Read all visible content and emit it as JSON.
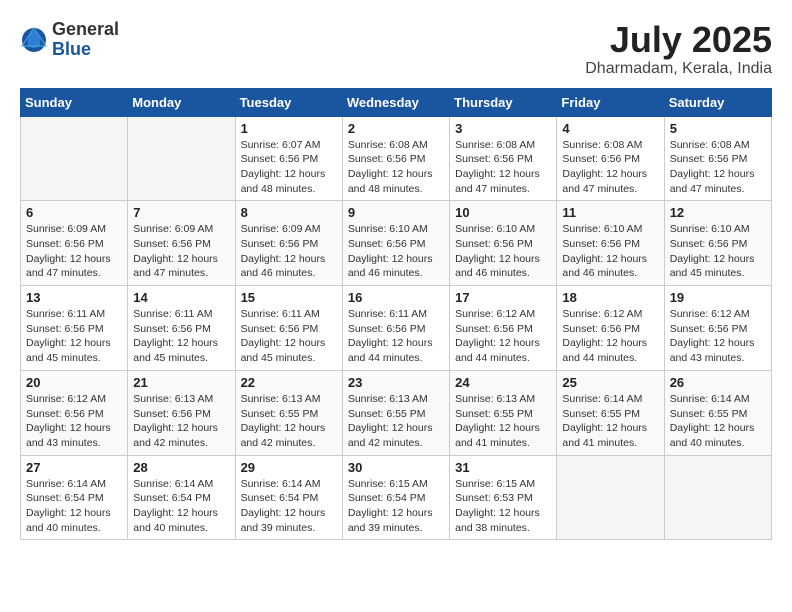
{
  "logo": {
    "general": "General",
    "blue": "Blue"
  },
  "title": "July 2025",
  "location": "Dharmadam, Kerala, India",
  "days_of_week": [
    "Sunday",
    "Monday",
    "Tuesday",
    "Wednesday",
    "Thursday",
    "Friday",
    "Saturday"
  ],
  "weeks": [
    [
      {
        "day": "",
        "info": ""
      },
      {
        "day": "",
        "info": ""
      },
      {
        "day": "1",
        "info": "Sunrise: 6:07 AM\nSunset: 6:56 PM\nDaylight: 12 hours and 48 minutes."
      },
      {
        "day": "2",
        "info": "Sunrise: 6:08 AM\nSunset: 6:56 PM\nDaylight: 12 hours and 48 minutes."
      },
      {
        "day": "3",
        "info": "Sunrise: 6:08 AM\nSunset: 6:56 PM\nDaylight: 12 hours and 47 minutes."
      },
      {
        "day": "4",
        "info": "Sunrise: 6:08 AM\nSunset: 6:56 PM\nDaylight: 12 hours and 47 minutes."
      },
      {
        "day": "5",
        "info": "Sunrise: 6:08 AM\nSunset: 6:56 PM\nDaylight: 12 hours and 47 minutes."
      }
    ],
    [
      {
        "day": "6",
        "info": "Sunrise: 6:09 AM\nSunset: 6:56 PM\nDaylight: 12 hours and 47 minutes."
      },
      {
        "day": "7",
        "info": "Sunrise: 6:09 AM\nSunset: 6:56 PM\nDaylight: 12 hours and 47 minutes."
      },
      {
        "day": "8",
        "info": "Sunrise: 6:09 AM\nSunset: 6:56 PM\nDaylight: 12 hours and 46 minutes."
      },
      {
        "day": "9",
        "info": "Sunrise: 6:10 AM\nSunset: 6:56 PM\nDaylight: 12 hours and 46 minutes."
      },
      {
        "day": "10",
        "info": "Sunrise: 6:10 AM\nSunset: 6:56 PM\nDaylight: 12 hours and 46 minutes."
      },
      {
        "day": "11",
        "info": "Sunrise: 6:10 AM\nSunset: 6:56 PM\nDaylight: 12 hours and 46 minutes."
      },
      {
        "day": "12",
        "info": "Sunrise: 6:10 AM\nSunset: 6:56 PM\nDaylight: 12 hours and 45 minutes."
      }
    ],
    [
      {
        "day": "13",
        "info": "Sunrise: 6:11 AM\nSunset: 6:56 PM\nDaylight: 12 hours and 45 minutes."
      },
      {
        "day": "14",
        "info": "Sunrise: 6:11 AM\nSunset: 6:56 PM\nDaylight: 12 hours and 45 minutes."
      },
      {
        "day": "15",
        "info": "Sunrise: 6:11 AM\nSunset: 6:56 PM\nDaylight: 12 hours and 45 minutes."
      },
      {
        "day": "16",
        "info": "Sunrise: 6:11 AM\nSunset: 6:56 PM\nDaylight: 12 hours and 44 minutes."
      },
      {
        "day": "17",
        "info": "Sunrise: 6:12 AM\nSunset: 6:56 PM\nDaylight: 12 hours and 44 minutes."
      },
      {
        "day": "18",
        "info": "Sunrise: 6:12 AM\nSunset: 6:56 PM\nDaylight: 12 hours and 44 minutes."
      },
      {
        "day": "19",
        "info": "Sunrise: 6:12 AM\nSunset: 6:56 PM\nDaylight: 12 hours and 43 minutes."
      }
    ],
    [
      {
        "day": "20",
        "info": "Sunrise: 6:12 AM\nSunset: 6:56 PM\nDaylight: 12 hours and 43 minutes."
      },
      {
        "day": "21",
        "info": "Sunrise: 6:13 AM\nSunset: 6:56 PM\nDaylight: 12 hours and 42 minutes."
      },
      {
        "day": "22",
        "info": "Sunrise: 6:13 AM\nSunset: 6:55 PM\nDaylight: 12 hours and 42 minutes."
      },
      {
        "day": "23",
        "info": "Sunrise: 6:13 AM\nSunset: 6:55 PM\nDaylight: 12 hours and 42 minutes."
      },
      {
        "day": "24",
        "info": "Sunrise: 6:13 AM\nSunset: 6:55 PM\nDaylight: 12 hours and 41 minutes."
      },
      {
        "day": "25",
        "info": "Sunrise: 6:14 AM\nSunset: 6:55 PM\nDaylight: 12 hours and 41 minutes."
      },
      {
        "day": "26",
        "info": "Sunrise: 6:14 AM\nSunset: 6:55 PM\nDaylight: 12 hours and 40 minutes."
      }
    ],
    [
      {
        "day": "27",
        "info": "Sunrise: 6:14 AM\nSunset: 6:54 PM\nDaylight: 12 hours and 40 minutes."
      },
      {
        "day": "28",
        "info": "Sunrise: 6:14 AM\nSunset: 6:54 PM\nDaylight: 12 hours and 40 minutes."
      },
      {
        "day": "29",
        "info": "Sunrise: 6:14 AM\nSunset: 6:54 PM\nDaylight: 12 hours and 39 minutes."
      },
      {
        "day": "30",
        "info": "Sunrise: 6:15 AM\nSunset: 6:54 PM\nDaylight: 12 hours and 39 minutes."
      },
      {
        "day": "31",
        "info": "Sunrise: 6:15 AM\nSunset: 6:53 PM\nDaylight: 12 hours and 38 minutes."
      },
      {
        "day": "",
        "info": ""
      },
      {
        "day": "",
        "info": ""
      }
    ]
  ]
}
